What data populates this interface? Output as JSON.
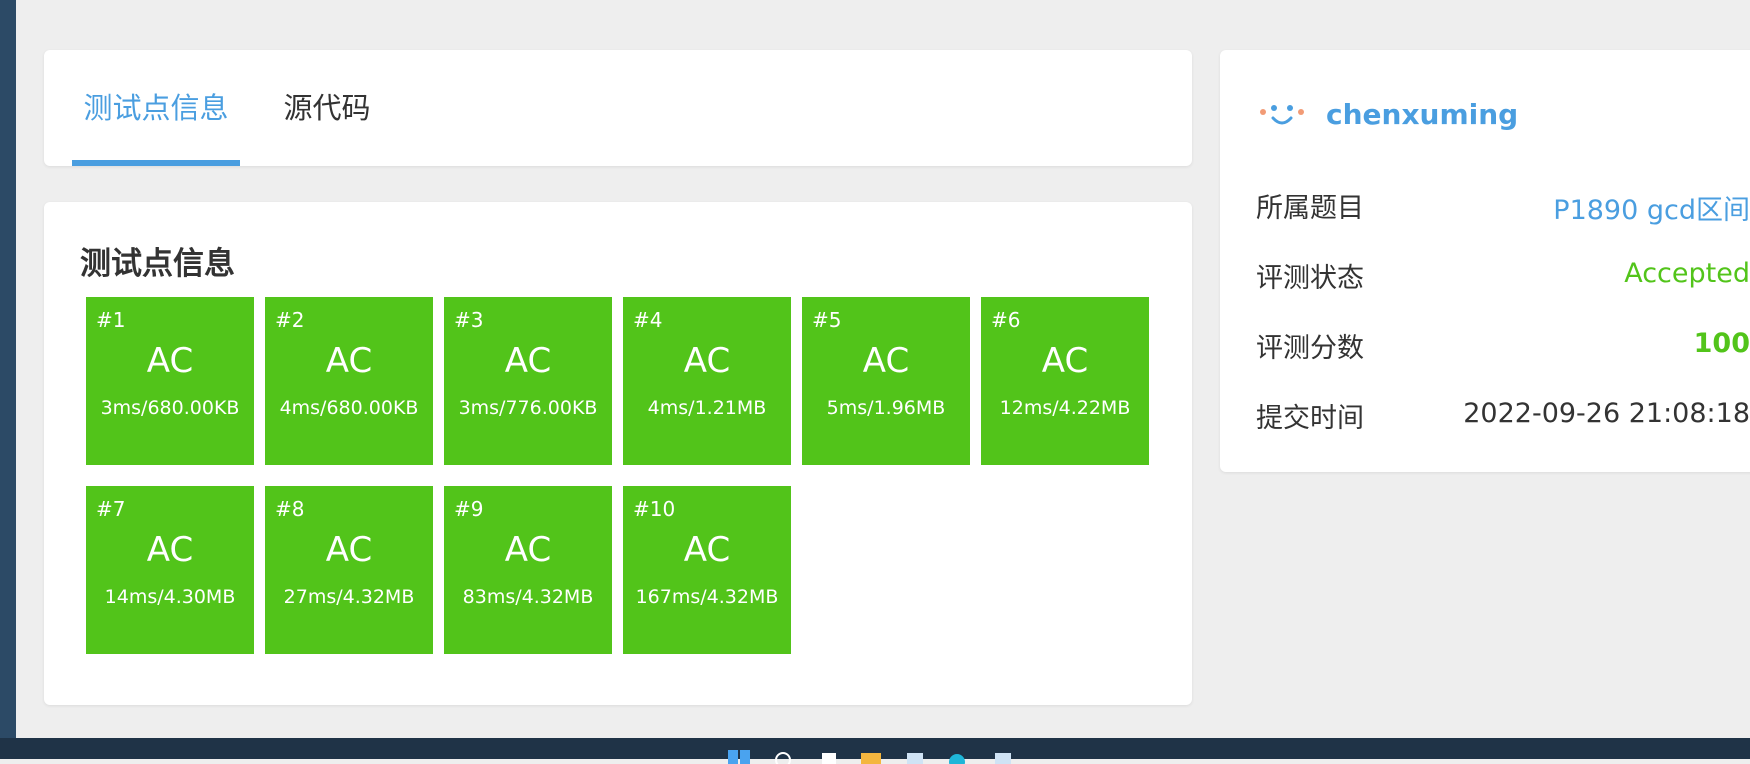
{
  "tabs": [
    {
      "label": "测试点信息",
      "active": true
    },
    {
      "label": "源代码",
      "active": false
    }
  ],
  "testcases": {
    "title": "测试点信息",
    "items": [
      {
        "id": "#1",
        "status": "AC",
        "info": "3ms/680.00KB"
      },
      {
        "id": "#2",
        "status": "AC",
        "info": "4ms/680.00KB"
      },
      {
        "id": "#3",
        "status": "AC",
        "info": "3ms/776.00KB"
      },
      {
        "id": "#4",
        "status": "AC",
        "info": "4ms/1.21MB"
      },
      {
        "id": "#5",
        "status": "AC",
        "info": "5ms/1.96MB"
      },
      {
        "id": "#6",
        "status": "AC",
        "info": "12ms/4.22MB"
      },
      {
        "id": "#7",
        "status": "AC",
        "info": "14ms/4.30MB"
      },
      {
        "id": "#8",
        "status": "AC",
        "info": "27ms/4.32MB"
      },
      {
        "id": "#9",
        "status": "AC",
        "info": "83ms/4.32MB"
      },
      {
        "id": "#10",
        "status": "AC",
        "info": "167ms/4.32MB"
      }
    ],
    "ac_color": "#52c41a"
  },
  "submission": {
    "username": "chenxuming",
    "avatar_icon": "smiley-face-icon",
    "rows": [
      {
        "label": "所属题目",
        "value": "P1890 gcd区间"
      },
      {
        "label": "评测状态",
        "value": "Accepted"
      },
      {
        "label": "评测分数",
        "value": "100"
      },
      {
        "label": "提交时间",
        "value": "2022-09-26 21:08:18"
      }
    ]
  },
  "colors": {
    "accent": "#4a9ee0",
    "success": "#52c41a",
    "background": "#eeeeee",
    "sidebar": "#2c4a66",
    "taskbar": "#1f3347"
  },
  "taskbar": {
    "icons": [
      "windows-start-icon",
      "search-icon",
      "file-icon",
      "folder-icon",
      "store-icon",
      "edge-browser-icon",
      "app-icon"
    ]
  }
}
